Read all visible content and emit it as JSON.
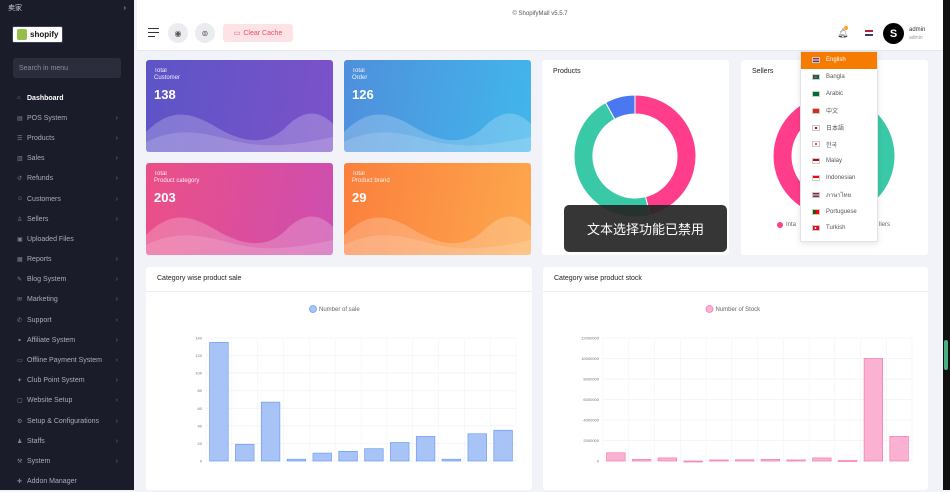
{
  "sidebar": {
    "top_label": "卖家",
    "logo_text": "shopify",
    "search_placeholder": "Search in menu",
    "items": [
      {
        "label": "Dashboard",
        "icon": "dashboard-icon",
        "active": true,
        "chevron": false
      },
      {
        "label": "POS System",
        "icon": "pos-icon",
        "chevron": true
      },
      {
        "label": "Products",
        "icon": "products-icon",
        "chevron": true
      },
      {
        "label": "Sales",
        "icon": "sales-icon",
        "chevron": true
      },
      {
        "label": "Refunds",
        "icon": "refunds-icon",
        "chevron": true
      },
      {
        "label": "Customers",
        "icon": "customers-icon",
        "chevron": true
      },
      {
        "label": "Sellers",
        "icon": "sellers-icon",
        "chevron": true
      },
      {
        "label": "Uploaded Files",
        "icon": "files-icon",
        "chevron": false
      },
      {
        "label": "Reports",
        "icon": "reports-icon",
        "chevron": true
      },
      {
        "label": "Blog System",
        "icon": "blog-icon",
        "chevron": true
      },
      {
        "label": "Marketing",
        "icon": "marketing-icon",
        "chevron": true
      },
      {
        "label": "Support",
        "icon": "support-icon",
        "chevron": true
      },
      {
        "label": "Affiliate System",
        "icon": "affiliate-icon",
        "chevron": true
      },
      {
        "label": "Offline Payment System",
        "icon": "payment-icon",
        "chevron": true
      },
      {
        "label": "Club Point System",
        "icon": "club-icon",
        "chevron": true
      },
      {
        "label": "Website Setup",
        "icon": "website-icon",
        "chevron": true
      },
      {
        "label": "Setup & Configurations",
        "icon": "setup-icon",
        "chevron": true
      },
      {
        "label": "Staffs",
        "icon": "staff-icon",
        "chevron": true
      },
      {
        "label": "System",
        "icon": "system-icon",
        "chevron": true
      },
      {
        "label": "Addon Manager",
        "icon": "addon-icon",
        "chevron": false
      }
    ]
  },
  "header": {
    "version": "© ShopifyMall v5.5.7",
    "clear_cache": "Clear Cache",
    "user_name": "admin",
    "user_role": "admin",
    "avatar_letter": "S"
  },
  "cards": [
    {
      "line1": "Total",
      "line2": "Customer",
      "value": "138",
      "from": "#5b54c7",
      "to": "#7d52c9"
    },
    {
      "line1": "Total",
      "line2": "Order",
      "value": "126",
      "from": "#4f8fdc",
      "to": "#41b7ec"
    },
    {
      "line1": "Total",
      "line2": "Product category",
      "value": "203",
      "from": "#ec4f86",
      "to": "#cd4eb0"
    },
    {
      "line1": "Total",
      "line2": "Product brand",
      "value": "29",
      "from": "#fb7f3c",
      "to": "#fda84e"
    }
  ],
  "products_panel": {
    "title": "Products"
  },
  "sellers_panel": {
    "title": "Sellers",
    "legend_left": "Inta",
    "legend_right": "llers"
  },
  "languages": [
    {
      "name": "English",
      "flag": "us",
      "selected": true
    },
    {
      "name": "Bangla",
      "flag": "bd"
    },
    {
      "name": "Arabic",
      "flag": "sa"
    },
    {
      "name": "中文",
      "flag": "cn"
    },
    {
      "name": "日本語",
      "flag": "jp"
    },
    {
      "name": "한국",
      "flag": "kr"
    },
    {
      "name": "Malay",
      "flag": "my"
    },
    {
      "name": "Indonesian",
      "flag": "id"
    },
    {
      "name": "ภาษาไทย",
      "flag": "th"
    },
    {
      "name": "Portuguese",
      "flag": "pt"
    },
    {
      "name": "Turkish",
      "flag": "tr"
    }
  ],
  "toast": "文本选择功能已禁用",
  "chart_data": [
    {
      "type": "pie",
      "title": "Products",
      "labels": [
        "",
        ""
      ],
      "values": [
        0.46,
        0.46,
        0.08
      ],
      "colors": [
        "#ff3d8b",
        "#3ac9a6",
        "#4a78f0"
      ]
    },
    {
      "type": "pie",
      "title": "Sellers",
      "labels": [
        "Inta",
        "llers"
      ],
      "values": [
        0.5,
        0.5
      ],
      "colors": [
        "#3ac9a6",
        "#ff3d8b"
      ]
    },
    {
      "type": "bar",
      "title": "Category wise product sale",
      "legend": "Number of sale",
      "color": "#a8c4f7",
      "stroke": "#6e9cf2",
      "ylim": [
        0,
        140
      ],
      "yticks": [
        0,
        20,
        40,
        60,
        80,
        100,
        120,
        140
      ],
      "values": [
        135,
        19,
        67,
        2,
        9,
        11,
        14,
        21,
        28,
        2,
        31,
        35
      ]
    },
    {
      "type": "bar",
      "title": "Category wise product stock",
      "legend": "Number of Stock",
      "color": "#fbb1d2",
      "stroke": "#f37aaf",
      "ylim": [
        0,
        12000000
      ],
      "yticks": [
        0,
        2000000,
        4000000,
        6000000,
        8000000,
        10000000,
        12000000
      ],
      "values": [
        800000,
        150000,
        300000,
        0,
        100000,
        120000,
        150000,
        100000,
        300000,
        50000,
        10000000,
        2400000
      ]
    }
  ]
}
